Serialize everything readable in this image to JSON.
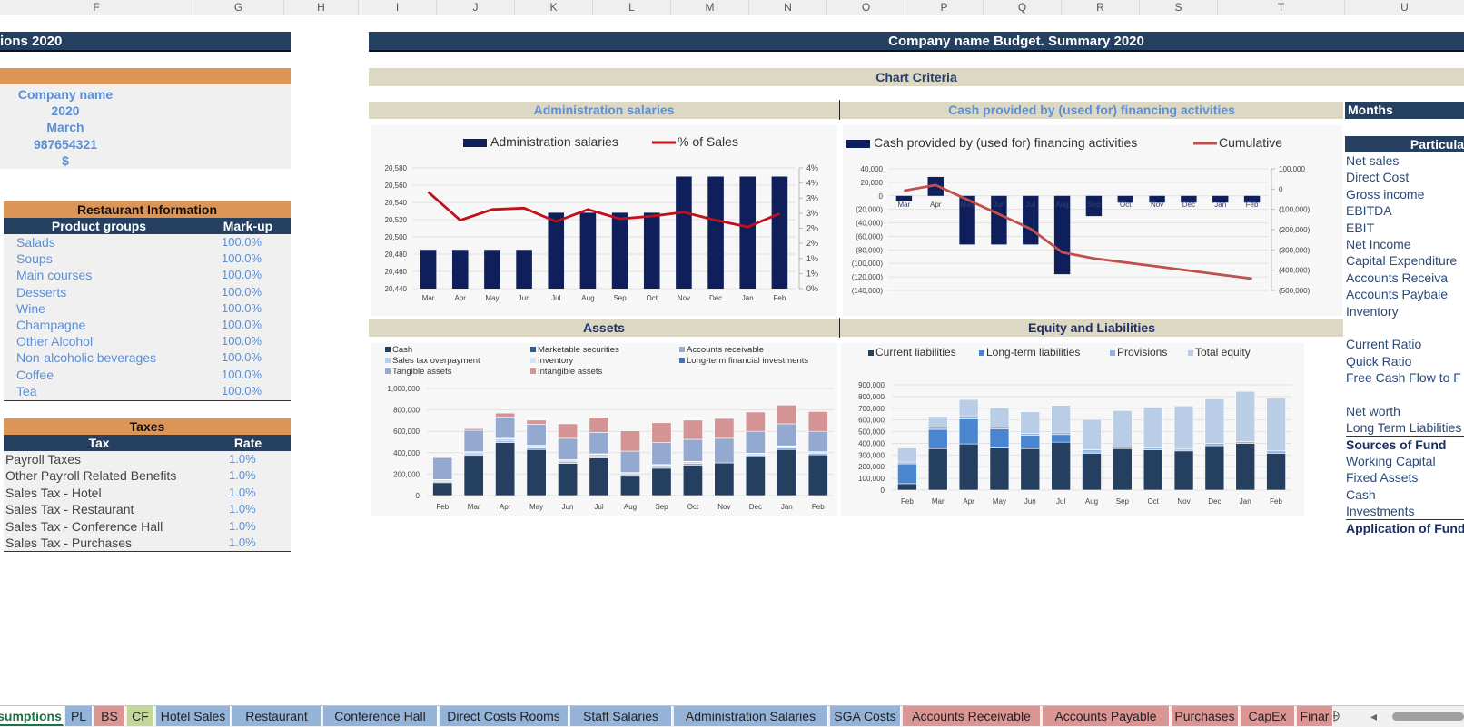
{
  "columns": [
    "F",
    "G",
    "H",
    "I",
    "J",
    "K",
    "L",
    "M",
    "N",
    "O",
    "P",
    "Q",
    "R",
    "S",
    "T",
    "U"
  ],
  "left": {
    "title": "ions 2020",
    "company": [
      "Company name",
      "2020",
      "March",
      "987654321",
      "$"
    ],
    "restaurant": {
      "title": "Restaurant Information",
      "headers": [
        "Product groups",
        "Mark-up"
      ],
      "rows": [
        [
          "Salads",
          "100.0%"
        ],
        [
          "Soups",
          "100.0%"
        ],
        [
          "Main courses",
          "100.0%"
        ],
        [
          "Desserts",
          "100.0%"
        ],
        [
          "Wine",
          "100.0%"
        ],
        [
          "Champagne",
          "100.0%"
        ],
        [
          "Other Alcohol",
          "100.0%"
        ],
        [
          "Non-alcoholic beverages",
          "100.0%"
        ],
        [
          "Coffee",
          "100.0%"
        ],
        [
          "Tea",
          "100.0%"
        ]
      ]
    },
    "taxes": {
      "title": "Taxes",
      "headers": [
        "Tax",
        "Rate"
      ],
      "rows": [
        [
          "Payroll Taxes",
          "1.0%"
        ],
        [
          "Other Payroll Related Benefits",
          "1.0%"
        ],
        [
          "Sales Tax - Hotel",
          "1.0%"
        ],
        [
          "Sales Tax - Restaurant",
          "1.0%"
        ],
        [
          "Sales Tax - Conference Hall",
          "1.0%"
        ],
        [
          "Sales Tax - Purchases",
          "1.0%"
        ]
      ]
    }
  },
  "main": {
    "title": "Company name Budget. Summary 2020",
    "criteria": "Chart Criteria",
    "months_label": "Months",
    "particulars_label": "Particula",
    "particulars": [
      "Net sales",
      "Direct Cost",
      "Gross income",
      "EBITDA",
      "EBIT",
      "Net Income",
      "Capital Expenditure",
      "Accounts Receiva",
      "Accounts Paybale",
      "Inventory",
      "",
      "Current Ratio",
      "Quick Ratio",
      "Free Cash Flow to F",
      "",
      "Net worth",
      "Long Term Liabilities",
      "Sources of Fund",
      "Working Capital",
      "Fixed Assets",
      "Cash",
      "Investments",
      "Application of Fund"
    ]
  },
  "chart_data": [
    {
      "type": "bar",
      "title": "Administration salaries",
      "categories": [
        "Mar",
        "Apr",
        "May",
        "Jun",
        "Jul",
        "Aug",
        "Sep",
        "Oct",
        "Nov",
        "Dec",
        "Jan",
        "Feb"
      ],
      "series": [
        {
          "name": "Administration salaries",
          "type": "bar",
          "color": "#0f1f5c",
          "values": [
            20485,
            20485,
            20485,
            20485,
            20528,
            20528,
            20528,
            20528,
            20570,
            20570,
            20570,
            20570
          ]
        },
        {
          "name": "% of Sales",
          "type": "line",
          "axis": "right",
          "color": "#c0101a",
          "values": [
            3.6,
            2.55,
            2.95,
            3.0,
            2.5,
            2.95,
            2.6,
            2.7,
            2.85,
            2.55,
            2.3,
            2.8
          ]
        }
      ],
      "ylim": [
        20440,
        20580
      ],
      "yticks": [
        "20,440",
        "20,460",
        "20,480",
        "20,500",
        "20,520",
        "20,540",
        "20,560",
        "20,580"
      ],
      "y2lim": [
        0,
        4.5
      ],
      "y2ticks": [
        "0%",
        "1%",
        "1%",
        "2%",
        "2%",
        "3%",
        "3%",
        "4%",
        "4%"
      ],
      "legend": "top"
    },
    {
      "type": "bar",
      "title": "Cash provided by (used for) financing activities",
      "categories": [
        "Mar",
        "Apr",
        "May",
        "Jun",
        "Jul",
        "Aug",
        "Sep",
        "Oct",
        "Nov",
        "Dec",
        "Jan",
        "Feb"
      ],
      "series": [
        {
          "name": "Cash provided by (used for) financing activities",
          "type": "bar",
          "color": "#0f1f5c",
          "values": [
            -8000,
            28000,
            -72000,
            -72000,
            -72000,
            -116000,
            -30000,
            -10000,
            -10000,
            -10000,
            -10000,
            -10000
          ]
        },
        {
          "name": "Cumulative",
          "type": "line",
          "axis": "right",
          "color": "#c0504d",
          "values": [
            -8000,
            20000,
            -52000,
            -124000,
            -196000,
            -312000,
            -342000,
            -362000,
            -382000,
            -402000,
            -422000,
            -442000
          ]
        }
      ],
      "ylim": [
        -140000,
        40000
      ],
      "yticks": [
        "(140,000)",
        "(120,000)",
        "(100,000)",
        "(80,000)",
        "(60,000)",
        "(40,000)",
        "(20,000)",
        "0",
        "20,000",
        "40,000"
      ],
      "y2lim": [
        -500000,
        100000
      ],
      "y2ticks": [
        "(500,000)",
        "(400,000)",
        "(300,000)",
        "(200,000)",
        "(100,000)",
        "0",
        "100,000"
      ],
      "legend": "top"
    },
    {
      "type": "bar",
      "stacked": true,
      "title": "Assets",
      "categories": [
        "Feb",
        "Mar",
        "Apr",
        "May",
        "Jun",
        "Jul",
        "Aug",
        "Sep",
        "Oct",
        "Nov",
        "Dec",
        "Jan",
        "Feb"
      ],
      "series": [
        {
          "name": "Cash",
          "color": "#243f5f",
          "values": [
            120000,
            375000,
            495000,
            430000,
            300000,
            350000,
            180000,
            255000,
            285000,
            305000,
            360000,
            430000,
            380000
          ]
        },
        {
          "name": "Marketable securities",
          "color": "#2d5b8f",
          "values": [
            0,
            0,
            0,
            0,
            0,
            0,
            0,
            0,
            0,
            0,
            0,
            0,
            0
          ]
        },
        {
          "name": "Accounts receivable",
          "color": "#94acd4",
          "values": [
            10000,
            15000,
            15000,
            15000,
            15000,
            15000,
            15000,
            15000,
            15000,
            0,
            15000,
            15000,
            15000
          ]
        },
        {
          "name": "Sales tax overpayment",
          "color": "#b9cde8",
          "values": [
            15000,
            15000,
            20000,
            20000,
            15000,
            20000,
            15000,
            15000,
            15000,
            0,
            15000,
            15000,
            10000
          ]
        },
        {
          "name": "Inventory",
          "color": "#d9e4f2",
          "values": [
            5000,
            5000,
            5000,
            5000,
            5000,
            5000,
            5000,
            5000,
            5000,
            0,
            5000,
            5000,
            5000
          ]
        },
        {
          "name": "Long-term financial investments",
          "color": "#4272b3",
          "values": [
            0,
            0,
            0,
            0,
            0,
            0,
            0,
            0,
            0,
            0,
            0,
            0,
            0
          ]
        },
        {
          "name": "Tangible assets",
          "color": "#94a9d0",
          "values": [
            205000,
            200000,
            200000,
            195000,
            200000,
            200000,
            200000,
            205000,
            205000,
            230000,
            205000,
            205000,
            190000
          ]
        },
        {
          "name": "Intangible assets",
          "color": "#d49494",
          "values": [
            10000,
            15000,
            35000,
            40000,
            135000,
            140000,
            190000,
            185000,
            180000,
            185000,
            180000,
            175000,
            185000
          ]
        }
      ],
      "ylim": [
        0,
        1000000
      ],
      "yticks": [
        "0",
        "200,000",
        "400,000",
        "600,000",
        "800,000",
        "1,000,000"
      ],
      "legend": "top"
    },
    {
      "type": "bar",
      "stacked": true,
      "title": "Equity and Liabilities",
      "categories": [
        "Feb",
        "Mar",
        "Apr",
        "May",
        "Jun",
        "Jul",
        "Aug",
        "Sep",
        "Oct",
        "Nov",
        "Dec",
        "Jan",
        "Feb"
      ],
      "series": [
        {
          "name": "Current liabilities",
          "color": "#243f5f",
          "values": [
            55000,
            355000,
            395000,
            360000,
            355000,
            410000,
            315000,
            355000,
            345000,
            335000,
            380000,
            400000,
            315000
          ]
        },
        {
          "name": "Long-term liabilities",
          "color": "#4a86d0",
          "values": [
            170000,
            165000,
            215000,
            165000,
            115000,
            65000,
            10000,
            0,
            0,
            0,
            0,
            0,
            0
          ]
        },
        {
          "name": "Provisions",
          "color": "#8fb1e0",
          "values": [
            15000,
            20000,
            25000,
            15000,
            15000,
            20000,
            20000,
            15000,
            15000,
            15000,
            20000,
            15000,
            20000
          ]
        },
        {
          "name": "Total equity",
          "color": "#b9cde6",
          "values": [
            120000,
            90000,
            140000,
            165000,
            185000,
            230000,
            260000,
            310000,
            350000,
            370000,
            380000,
            430000,
            450000
          ]
        }
      ],
      "ylim": [
        0,
        900000
      ],
      "yticks": [
        "0",
        "100,000",
        "200,000",
        "300,000",
        "400,000",
        "500,000",
        "600,000",
        "700,000",
        "800,000",
        "900,000"
      ],
      "legend": "top"
    }
  ],
  "sheet_tabs": [
    {
      "label": "sumptions",
      "color": "#ffffff",
      "active": true
    },
    {
      "label": "PL",
      "color": "#95b3d7"
    },
    {
      "label": "BS",
      "color": "#da9694"
    },
    {
      "label": "CF",
      "color": "#c4d79b"
    },
    {
      "label": "Hotel Sales",
      "color": "#95b3d7"
    },
    {
      "label": "Restaurant",
      "color": "#95b3d7"
    },
    {
      "label": "Conference Hall",
      "color": "#95b3d7"
    },
    {
      "label": "Direct Costs Rooms",
      "color": "#95b3d7"
    },
    {
      "label": "Staff Salaries",
      "color": "#95b3d7"
    },
    {
      "label": "Administration Salaries",
      "color": "#95b3d7"
    },
    {
      "label": "SGA Costs",
      "color": "#95b3d7"
    },
    {
      "label": "Accounts Receivable",
      "color": "#da9694"
    },
    {
      "label": "Accounts Payable",
      "color": "#da9694"
    },
    {
      "label": "Purchases",
      "color": "#da9694"
    },
    {
      "label": "CapEx",
      "color": "#da9694"
    },
    {
      "label": "Finar",
      "color": "#da9694"
    }
  ],
  "tab_overflow": "...",
  "icons": {
    "add_sheet": "⊕",
    "scroll_left": "◂"
  }
}
